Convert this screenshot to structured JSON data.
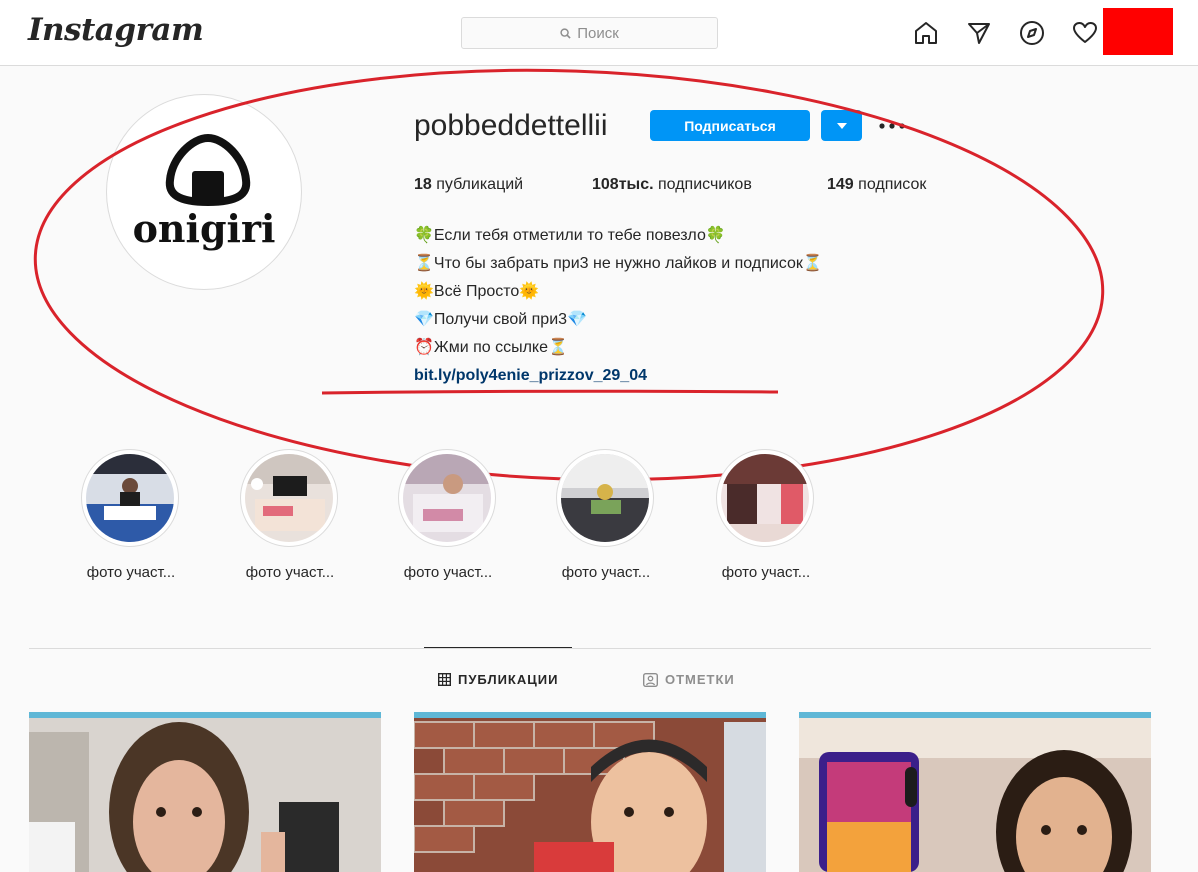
{
  "header": {
    "logo": "Instagram",
    "search_placeholder": "Поиск",
    "nav_icons": [
      "home-icon",
      "direct-icon",
      "explore-icon",
      "heart-icon"
    ]
  },
  "profile": {
    "avatar_text": "onigiri",
    "username": "pobbeddettellii",
    "follow_label": "Подписаться",
    "stats": {
      "posts_count": "18",
      "posts_label": "публикаций",
      "followers_count": "108тыс.",
      "followers_label": "подписчиков",
      "following_count": "149",
      "following_label": "подписок"
    },
    "bio": [
      "🍀Если тебя отметили то тебе повезло🍀",
      "⏳Что бы забрать при3 не нужно лайков и подписок⏳",
      "🌞Всё Просто🌞",
      "💎Получи свой при3💎",
      "⏰Жми по ссылке⏳"
    ],
    "link": "bit.ly/poly4enie_prizzov_29_04"
  },
  "highlights": [
    {
      "label": "фото участ..."
    },
    {
      "label": "фото участ..."
    },
    {
      "label": "фото участ..."
    },
    {
      "label": "фото участ..."
    },
    {
      "label": "фото участ..."
    }
  ],
  "tabs": {
    "posts": "ПУБЛИКАЦИИ",
    "tagged": "ОТМЕТКИ"
  },
  "colors": {
    "accent": "#0095f6",
    "annotation": "#d9232b",
    "redacted": "#ff0000"
  }
}
